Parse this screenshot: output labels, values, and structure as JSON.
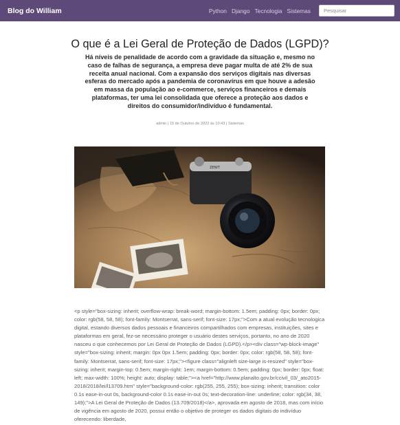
{
  "nav": {
    "brand": "Blog do William",
    "links": [
      "Python",
      "Django",
      "Tecnologia",
      "Sistemas"
    ],
    "search_placeholder": "Pesquisar"
  },
  "post": {
    "title": "O que é a Lei Geral de Proteção de Dados (LGPD)?",
    "subtitle": "Há níveis de penalidade de acordo com a gravidade da situação e, mesmo no caso de falhas de segurança, a empresa deve pagar multa de até 2% de sua receita anual nacional. Com a expansão dos serviços digitais nas diversas esferas do mercado após a pandemia de coronavírus em que houve a adesão em massa da população ao e-commerce, serviços financeiros e demais plataformas, ter uma lei consolidada que oferece a proteção aos dados e direitos do consumidor/indivíduo é fundamental.",
    "meta": "admin | 15 de Outubro de 2022 às 10:43 | Sistemas",
    "body_raw": "<p style=\"box-sizing: inherit; overflow-wrap: break-word; margin-bottom: 1.5em; padding: 0px; border: 0px; color: rgb(58, 58, 58); font-family: Montserrat, sans-serif; font-size: 17px;\">Com a atual evolução tecnologica digital, estando diversos dados pessoais e financeiros compartilhados com empresas, instituições, sites e plataformas em geral, fez-se necessário proteger o usuário destes serviços, portanto, no ano de 2020 nasceu o que conhecemos por Lei Geral de Proteção de Dados (LGPD).</p><div class=\"wp-block-image\" style=\"box-sizing: inherit; margin: 0px 0px 1.5em; padding: 0px; border: 0px; color: rgb(58, 58, 58); font-family: Montserrat, sans-serif; font-size: 17px;\"><figure class=\"alignleft size-large is-resized\" style=\"box-sizing: inherit; margin-top: 0.5em; margin-right: 1em; margin-bottom: 0.5em; padding: 0px; border: 0px; float: left; max-width: 100%; height: auto; display: table;\"><a href=\"http://www.planalto.gov.br/ccivil_03/_ato2015-2018/2018/lei/l13709.htm\" style=\"background-color: rgb(255, 255, 255); box-sizing: inherit; transition: color 0.1s ease-in-out 0s, background-color 0.1s ease-in-out 0s; text-decoration-line: underline; color: rgb(34, 38, 149);\">A Lei Geral de Proteção de Dados (13.709/2018)</a>, aprovada em agosto de 2018, mas com início de vigência em agosto de 2020, possui então o objetivo de proteger os dados digitais do indivíduo oferecendo: liberdade,"
  }
}
